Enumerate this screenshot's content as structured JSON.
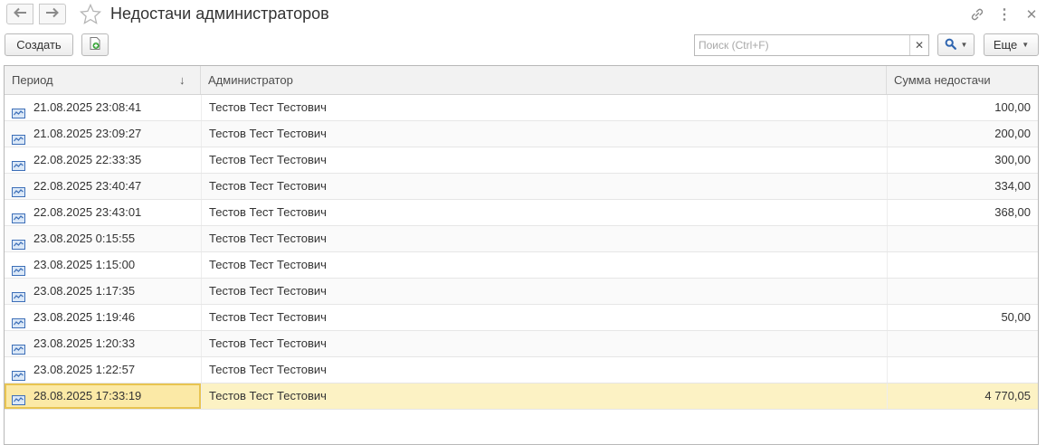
{
  "window": {
    "title": "Недостачи администраторов"
  },
  "toolbar": {
    "create_label": "Создать",
    "search_placeholder": "Поиск (Ctrl+F)",
    "more_label": "Еще"
  },
  "table": {
    "columns": {
      "period": "Период",
      "admin": "Администратор",
      "sum": "Сумма недостачи"
    },
    "sort_indicator": "↓",
    "rows": [
      {
        "period": "21.08.2025 23:08:41",
        "admin": "Тестов Тест Тестович",
        "sum": "100,00"
      },
      {
        "period": "21.08.2025 23:09:27",
        "admin": "Тестов Тест Тестович",
        "sum": "200,00"
      },
      {
        "period": "22.08.2025 22:33:35",
        "admin": "Тестов Тест Тестович",
        "sum": "300,00"
      },
      {
        "period": "22.08.2025 23:40:47",
        "admin": "Тестов Тест Тестович",
        "sum": "334,00"
      },
      {
        "period": "22.08.2025 23:43:01",
        "admin": "Тестов Тест Тестович",
        "sum": "368,00"
      },
      {
        "period": "23.08.2025 0:15:55",
        "admin": "Тестов Тест Тестович",
        "sum": ""
      },
      {
        "period": "23.08.2025 1:15:00",
        "admin": "Тестов Тест Тестович",
        "sum": ""
      },
      {
        "period": "23.08.2025 1:17:35",
        "admin": "Тестов Тест Тестович",
        "sum": ""
      },
      {
        "period": "23.08.2025 1:19:46",
        "admin": "Тестов Тест Тестович",
        "sum": "50,00"
      },
      {
        "period": "23.08.2025 1:20:33",
        "admin": "Тестов Тест Тестович",
        "sum": ""
      },
      {
        "period": "23.08.2025 1:22:57",
        "admin": "Тестов Тест Тестович",
        "sum": ""
      },
      {
        "period": "28.08.2025 17:33:19",
        "admin": "Тестов Тест Тестович",
        "sum": "4 770,05",
        "selected": true
      }
    ]
  },
  "icons": {
    "back": "arrow-left-icon",
    "forward": "arrow-right-icon",
    "favorite": "star-icon",
    "link": "link-icon",
    "more": "more-vertical-icon",
    "close": "close-icon",
    "save": "save-document-icon",
    "find": "search-icon",
    "record": "register-record-icon"
  },
  "colors": {
    "selection_row": "#fcf2c4",
    "selection_cell_border": "#e8c451",
    "header_bg": "#f2f2f2",
    "record_icon": "#3d6fb8"
  }
}
